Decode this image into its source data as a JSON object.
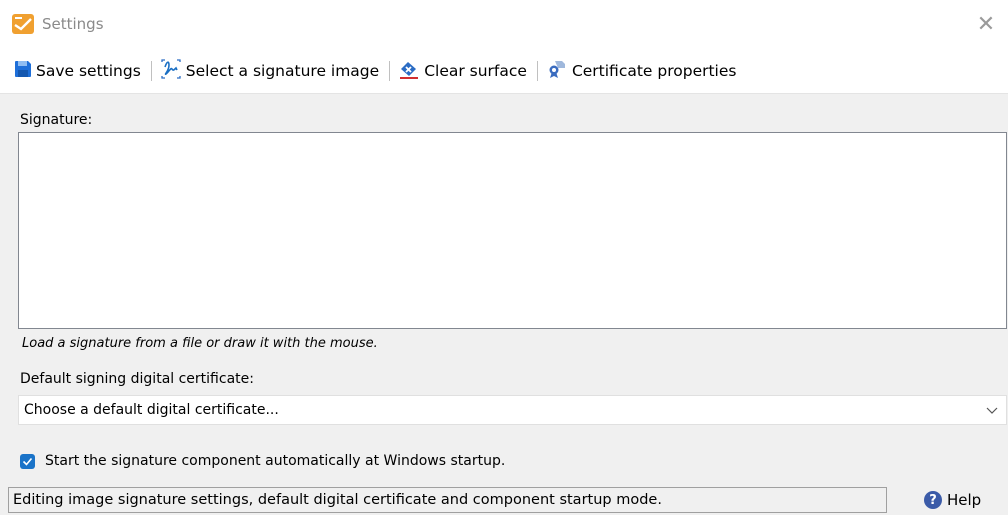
{
  "window": {
    "title": "Settings",
    "close_glyph": "✕"
  },
  "toolbar": {
    "items": [
      {
        "label": "Save settings",
        "icon": "save-icon"
      },
      {
        "label": "Select a signature image",
        "icon": "signature-image-icon"
      },
      {
        "label": "Clear surface",
        "icon": "eraser-icon"
      },
      {
        "label": "Certificate properties",
        "icon": "certificate-icon"
      }
    ]
  },
  "signature": {
    "label": "Signature:",
    "hint": "Load a signature from a file or draw it with the mouse."
  },
  "certificate": {
    "label": "Default signing digital certificate:",
    "selected": "Choose a default digital certificate..."
  },
  "startup": {
    "checked": true,
    "label": "Start the signature component automatically at Windows startup."
  },
  "statusbar": {
    "text": "Editing image signature settings, default digital certificate and component startup mode.",
    "help_label": "Help",
    "help_glyph": "?"
  },
  "colors": {
    "accent": "#1a73c8",
    "app_icon": "#f0a030",
    "save_icon": "#1e6fd9",
    "eraser_icon": "#2b6cc4",
    "eraser_underline": "#d32f2f"
  }
}
